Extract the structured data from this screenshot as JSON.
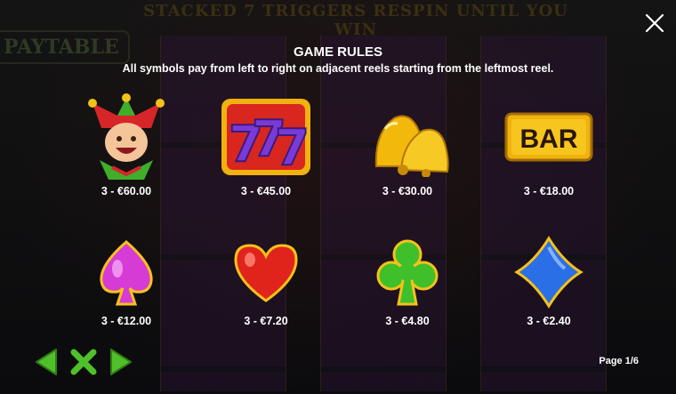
{
  "background": {
    "banner": "STACKED 7 TRIGGERS RESPIN UNTIL YOU WIN",
    "paytable": "PAYTABLE"
  },
  "rules": {
    "title": "GAME RULES",
    "subtitle": "All symbols pay from left to right on adjacent reels starting from the leftmost reel."
  },
  "symbols": [
    {
      "icon": "jester-icon",
      "payout": "3 - €60.00"
    },
    {
      "icon": "lucky-777-icon",
      "payout": "3 - €45.00"
    },
    {
      "icon": "golden-bells-icon",
      "payout": "3 - €30.00"
    },
    {
      "icon": "bar-icon",
      "label": "BAR",
      "payout": "3 - €18.00"
    },
    {
      "icon": "spade-icon",
      "payout": "3 - €12.00"
    },
    {
      "icon": "heart-icon",
      "payout": "3 - €7.20"
    },
    {
      "icon": "club-icon",
      "payout": "3 - €4.80"
    },
    {
      "icon": "diamond-icon",
      "payout": "3 - €2.40"
    }
  ],
  "pagination": {
    "label": "Page 1/6"
  },
  "colors": {
    "accent_green": "#4fc02a",
    "text": "#ffffff"
  }
}
